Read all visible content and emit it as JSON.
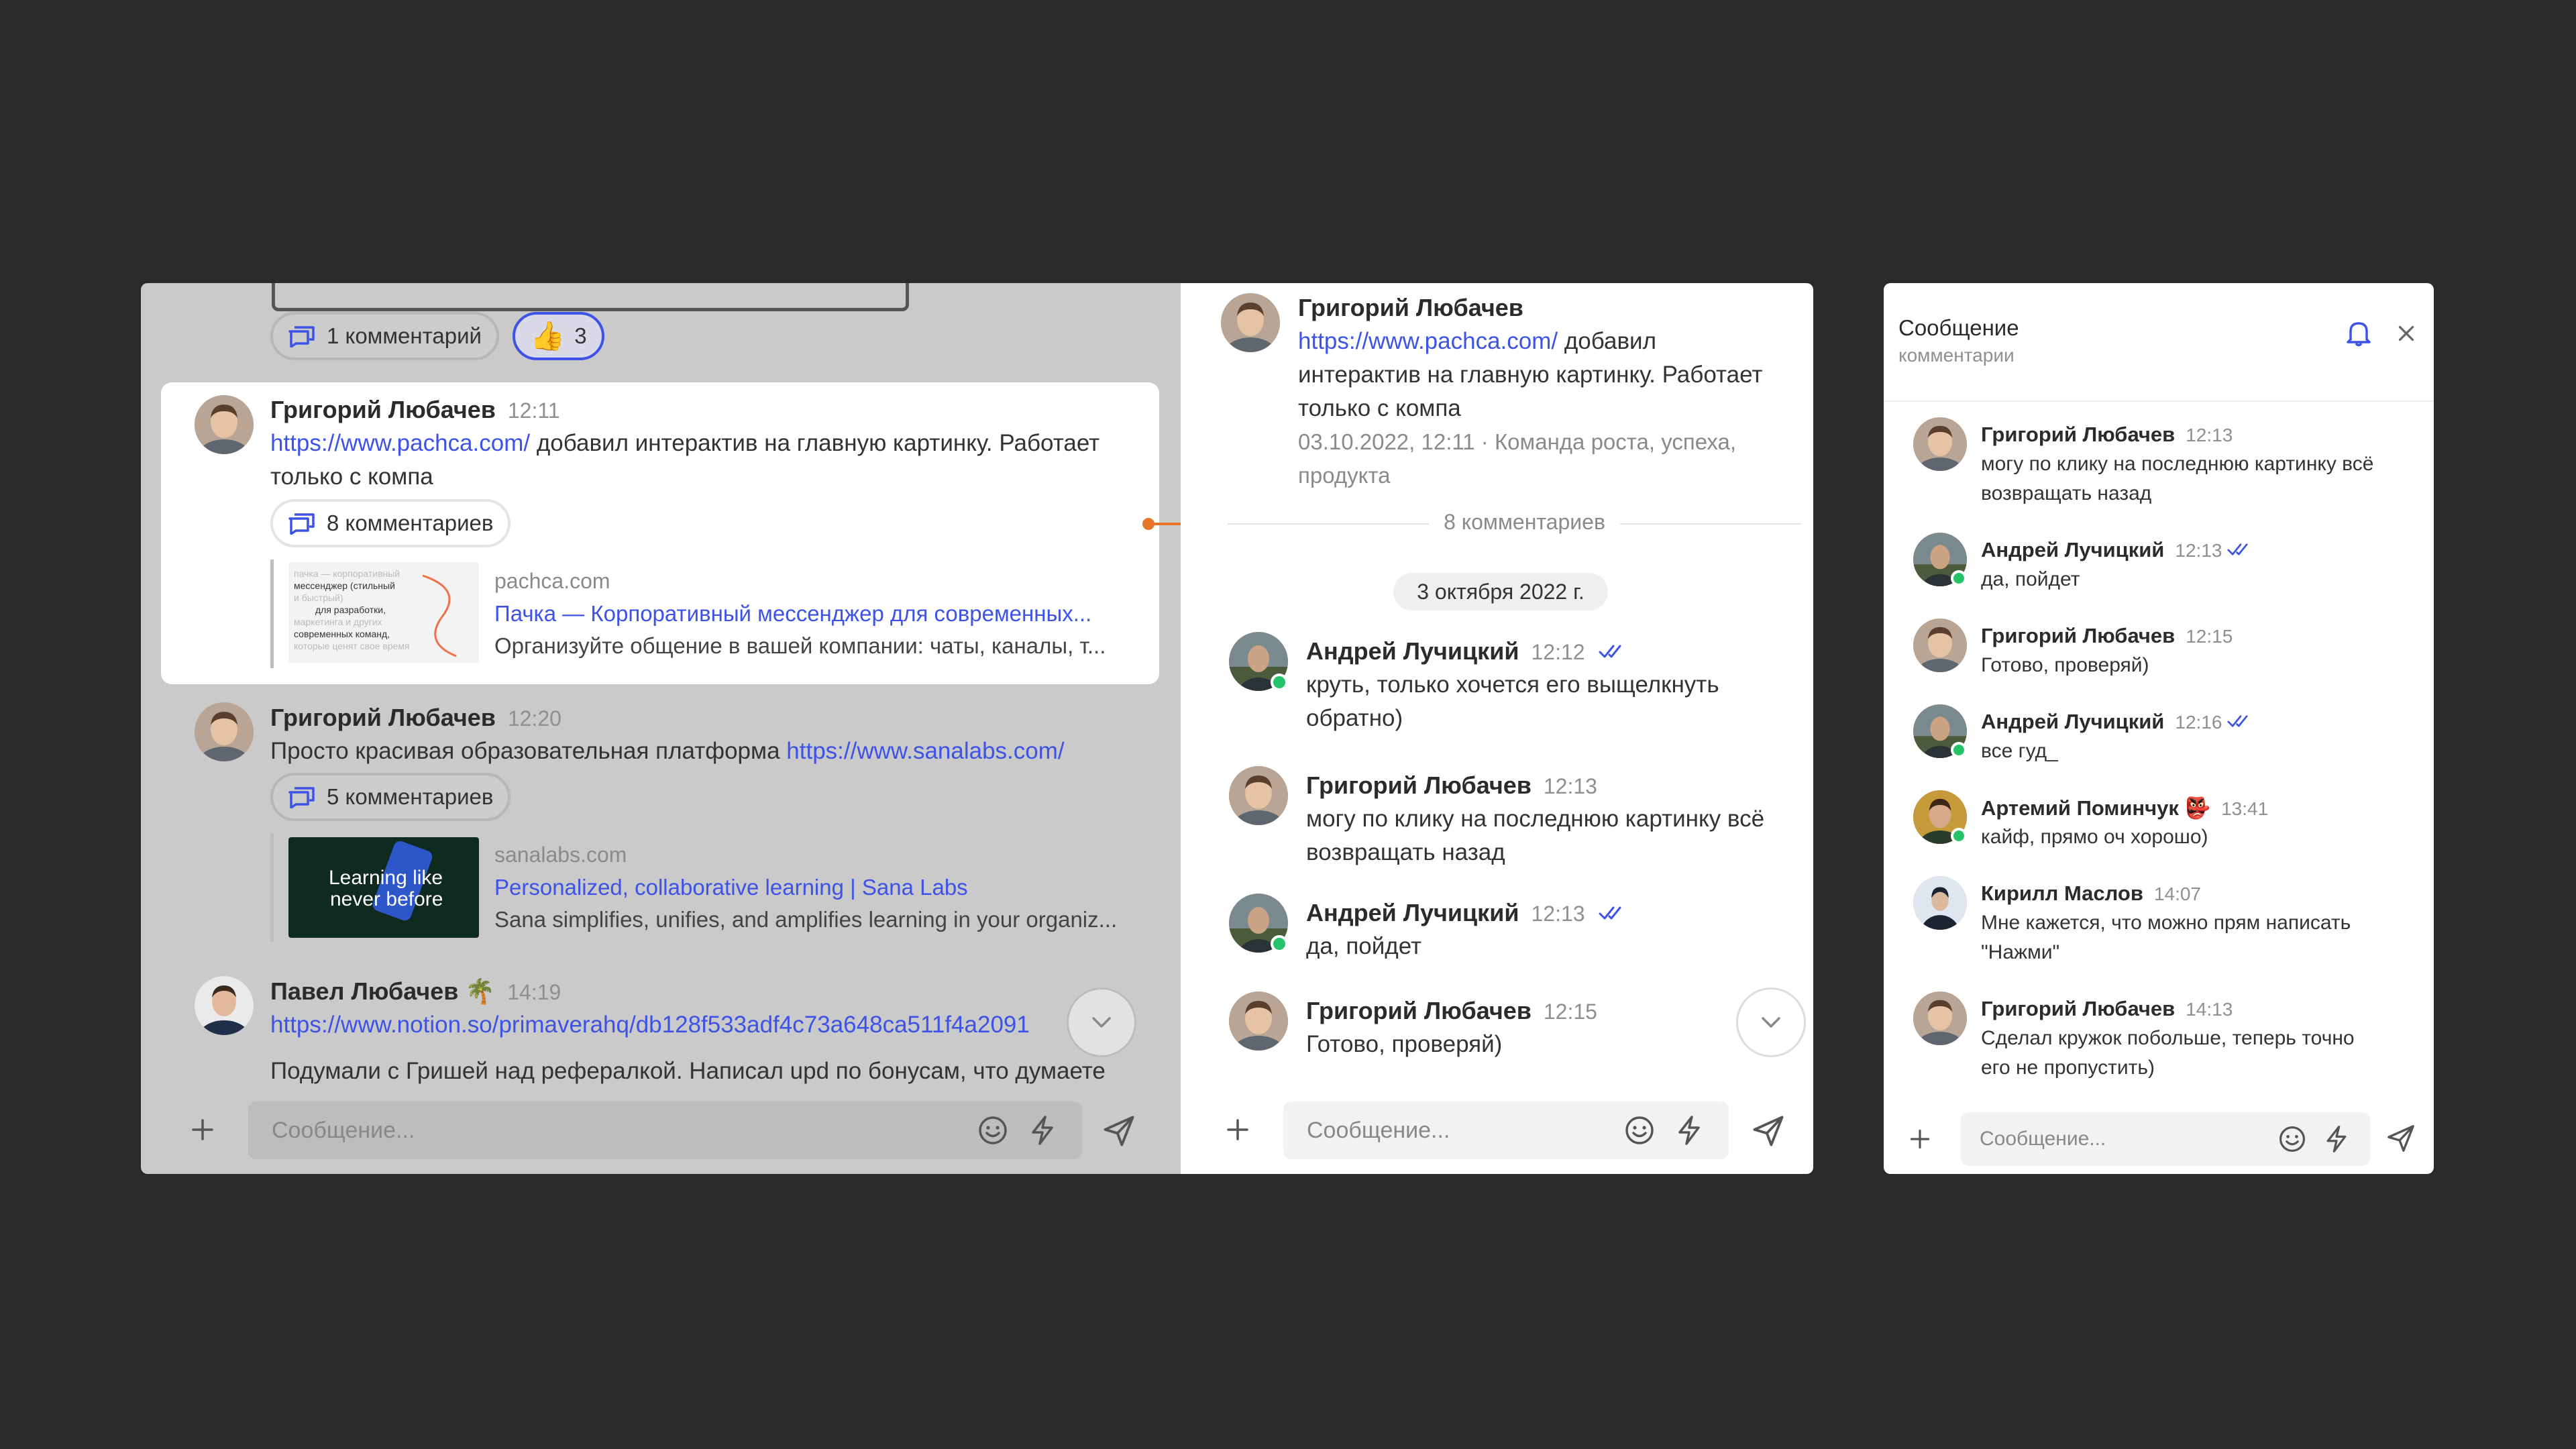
{
  "icons": [
    "comment-icon",
    "thumbs-up-icon",
    "plus-icon",
    "emoji-icon",
    "lightning-icon",
    "send-icon",
    "chevron-down-icon",
    "double-check-icon",
    "bell-icon",
    "close-icon",
    "arrow-right-icon"
  ],
  "colors": {
    "accent": "#3d52e6",
    "arrow": "#e8762a",
    "online": "#25c36a",
    "background": "#2a2a2a"
  },
  "channel": {
    "top_comments_label": "1 комментарий",
    "like_count": "3",
    "messages": [
      {
        "author": "Григорий Любачев",
        "time": "12:11",
        "link": "https://www.pachca.com/",
        "text": "добавил интерактив на главную картинку. Работает",
        "text2": "только с компа",
        "comments": "8 комментариев",
        "preview": {
          "domain": "pachca.com",
          "title": "Пачка — Корпоративный мессенджер для современных...",
          "desc": "Организуйте общение в вашей компании: чаты, каналы, т...",
          "thumb_lines": [
            "пачка — корпоративный",
            "мессенджер (стильный",
            "и быстрый)",
            "для разработки,",
            "маркетинга и других",
            "современных команд,",
            "которые ценят свое время"
          ]
        }
      },
      {
        "author": "Григорий Любачев",
        "time": "12:20",
        "text": "Просто красивая образовательная платформа",
        "link": "https://www.sanalabs.com/",
        "comments": "5 комментариев",
        "preview": {
          "domain": "sanalabs.com",
          "title": "Personalized, collaborative learning | Sana Labs",
          "desc": "Sana simplifies, unifies, and amplifies learning in your organiz...",
          "thumb_lines": [
            "Learning like",
            "never before"
          ]
        }
      },
      {
        "author": "Павел Любачев",
        "emoji": "🌴",
        "time": "14:19",
        "link": "https://www.notion.so/primaverahq/db128f533adf4c73a648ca511f4a2091",
        "text": "Подумали с Гришей над рефералкой. Написал upd по бонусам, что думаете"
      }
    ],
    "composer_placeholder": "Сообщение..."
  },
  "thread": {
    "author": "Григорий Любачев",
    "link": "https://www.pachca.com/",
    "text_after_link": "добавил",
    "text_line2": "интерактив на главную картинку. Работает",
    "text_line3": "только с компа",
    "meta_line1": "03.10.2022, 12:11 · Команда роста, успеха,",
    "meta_line2": "продукта",
    "comments_divider": "8 комментариев",
    "date_chip": "3 октября 2022 г.",
    "replies": [
      {
        "author": "Андрей Лучицкий",
        "time": "12:12",
        "line1": "круть, только хочется его выщелкнуть",
        "line2": "обратно)"
      },
      {
        "author": "Григорий Любачев",
        "time": "12:13",
        "line1": "могу по клику на последнюю картинку всё",
        "line2": "возвращать назад"
      },
      {
        "author": "Андрей Лучицкий",
        "time": "12:13",
        "line1": "да, пойдет"
      },
      {
        "author": "Григорий Любачев",
        "time": "12:15",
        "line1": "Готово, проверяй)"
      }
    ],
    "composer_placeholder": "Сообщение..."
  },
  "side_panel": {
    "title": "Сообщение",
    "subtitle": "комментарии",
    "comments": [
      {
        "author": "Григорий Любачев",
        "time": "12:13",
        "line1": "могу по клику на последнюю картинку всё",
        "line2": "возвращать назад"
      },
      {
        "author": "Андрей Лучицкий",
        "time": "12:13",
        "line1": "да, пойдет"
      },
      {
        "author": "Григорий Любачев",
        "time": "12:15",
        "line1": "Готово, проверяй)"
      },
      {
        "author": "Андрей Лучицкий",
        "time": "12:16",
        "line1": "все гуд_"
      },
      {
        "author": "Артемий Поминчук",
        "emoji": "👺",
        "time": "13:41",
        "line1": "кайф, прямо оч хорошо)"
      },
      {
        "author": "Кирилл Маслов",
        "time": "14:07",
        "line1": "Мне кажется, что можно прям написать",
        "line2": "\"Нажми\""
      },
      {
        "author": "Григорий Любачев",
        "time": "14:13",
        "line1": "Сделал кружок побольше, теперь точно",
        "line2": "его не пропустить)"
      }
    ],
    "composer_placeholder": "Сообщение..."
  }
}
